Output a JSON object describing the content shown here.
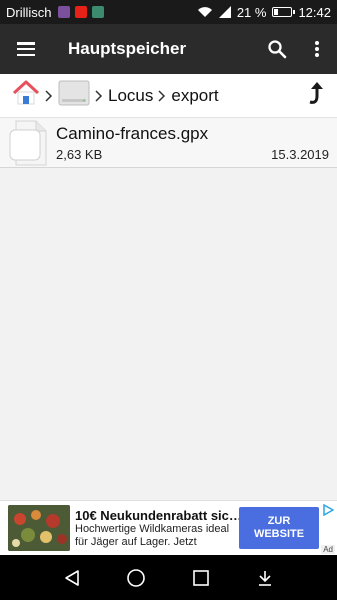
{
  "status_bar": {
    "carrier": "Drillisch",
    "battery_text": "21 %",
    "time": "12:42",
    "app_icons": [
      "viber-icon",
      "youtube-icon",
      "app-icon"
    ],
    "colors": {
      "viber": "#7b519d",
      "youtube": "#e62117",
      "app": "#3d8b6e"
    }
  },
  "app_bar": {
    "title": "Hauptspeicher"
  },
  "breadcrumb": {
    "items": [
      "Locus",
      "export"
    ]
  },
  "files": [
    {
      "name": "Camino-frances.gpx",
      "size": "2,63 KB",
      "date": "15.3.2019"
    }
  ],
  "ad": {
    "title": "10€ Neukundenrabatt sic…",
    "body": "Hochwertige Wildkameras ideal für Jäger auf Lager. Jetzt",
    "cta": "ZUR WEBSITE",
    "label": "Ad",
    "cta_color": "#4a6ee0"
  }
}
